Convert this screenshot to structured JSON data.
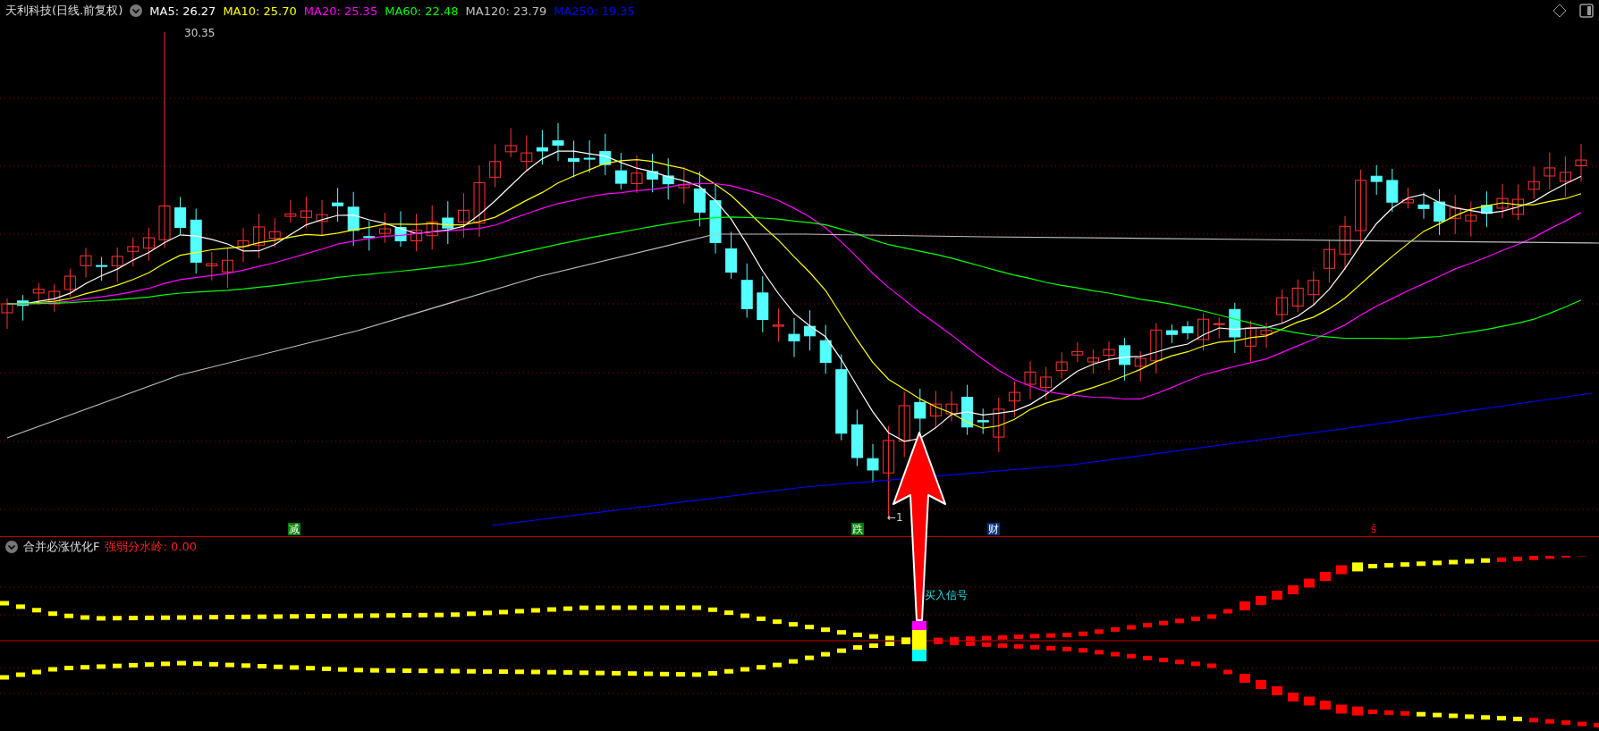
{
  "header": {
    "title": "天利科技(日线.前复权)",
    "moving_averages": [
      {
        "label": "MA5: 26.27",
        "color": "#ffffff"
      },
      {
        "label": "MA10: 25.70",
        "color": "#ffff00"
      },
      {
        "label": "MA20: 25.35",
        "color": "#ff00ff"
      },
      {
        "label": "MA60: 22.48",
        "color": "#00ff00"
      },
      {
        "label": "MA120: 23.79",
        "color": "#c0c0c0"
      },
      {
        "label": "MA250: 19.35",
        "color": "#0000ff"
      }
    ]
  },
  "price_chart": {
    "high_label": "30.35",
    "low_label": "←1"
  },
  "event_markers": [
    {
      "label": "减",
      "kind": "badge",
      "color": "#008000"
    },
    {
      "label": "跌",
      "kind": "badge",
      "color": "#008000"
    },
    {
      "label": "财",
      "kind": "badge",
      "color": "#003080"
    },
    {
      "label": "ŝ",
      "kind": "text",
      "color": "#ff0000"
    }
  ],
  "indicator": {
    "title": "合并必涨优化F",
    "threshold_label": "强弱分水岭: 0.00",
    "signal_label": "买入信号"
  }
}
